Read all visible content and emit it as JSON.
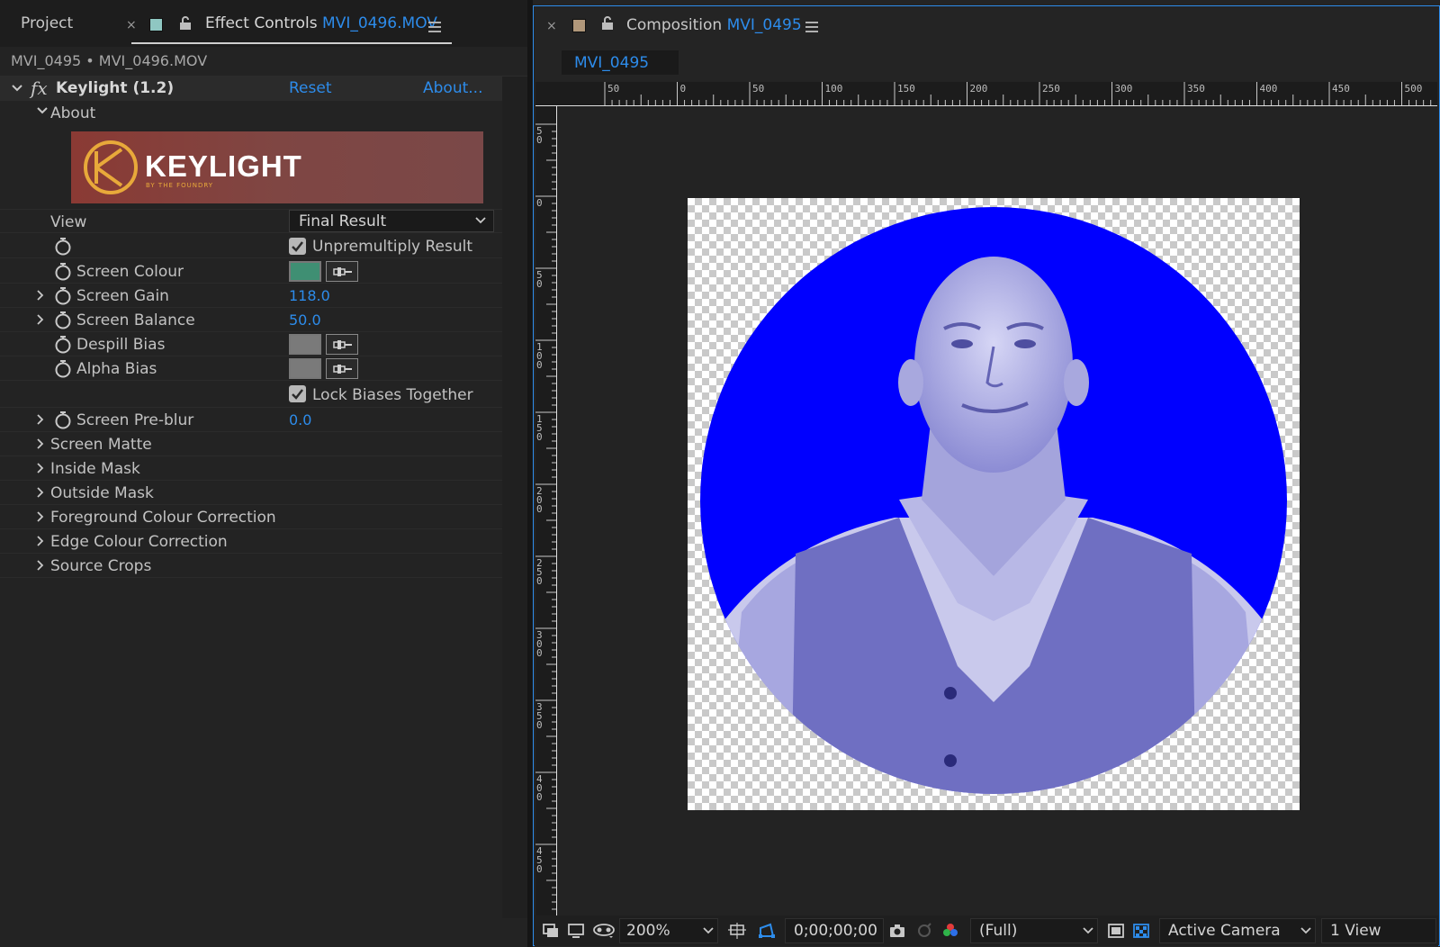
{
  "left_tabs": {
    "project": "Project",
    "close": "×",
    "effect_controls_prefix": "Effect Controls",
    "effect_controls_file": "MVI_0496.MOV"
  },
  "effect_header": "MVI_0495 • MVI_0496.MOV",
  "effect": {
    "fx": "fx",
    "name": "Keylight (1.2)",
    "reset": "Reset",
    "about": "About...",
    "about_section": "About",
    "logo_text": "KEYLIGHT",
    "logo_sub": "BY THE FOUNDRY"
  },
  "params": {
    "view_label": "View",
    "view_value": "Final Result",
    "unpremultiply": "Unpremultiply Result",
    "screen_colour": "Screen Colour",
    "screen_colour_hex": "#3f8f73",
    "screen_gain": "Screen Gain",
    "screen_gain_value": "118.0",
    "screen_balance": "Screen Balance",
    "screen_balance_value": "50.0",
    "despill_bias": "Despill Bias",
    "despill_bias_hex": "#7a7a7a",
    "alpha_bias": "Alpha Bias",
    "alpha_bias_hex": "#7a7a7a",
    "lock_biases": "Lock Biases Together",
    "screen_preblur": "Screen Pre-blur",
    "screen_preblur_value": "0.0",
    "screen_matte": "Screen Matte",
    "inside_mask": "Inside Mask",
    "outside_mask": "Outside Mask",
    "foreground_cc": "Foreground Colour Correction",
    "edge_cc": "Edge Colour Correction",
    "source_crops": "Source Crops"
  },
  "composition": {
    "close": "×",
    "title_prefix": "Composition",
    "title_name": "MVI_0495",
    "subtab": "MVI_0495",
    "ruler_top": [
      "50",
      "0",
      "50",
      "100",
      "150",
      "200",
      "250",
      "300",
      "350",
      "400",
      "450",
      "500"
    ],
    "ruler_left": [
      "50",
      "0",
      "50",
      "100",
      "150",
      "200",
      "250",
      "300",
      "350",
      "400",
      "450"
    ],
    "circle_color": "#0000ff"
  },
  "bottom_bar": {
    "zoom": "200%",
    "timecode": "0;00;00;00",
    "resolution": "(Full)",
    "camera": "Active Camera",
    "views": "1 View"
  },
  "colors": {
    "accent": "#2d8ceb",
    "panel": "#232323"
  }
}
